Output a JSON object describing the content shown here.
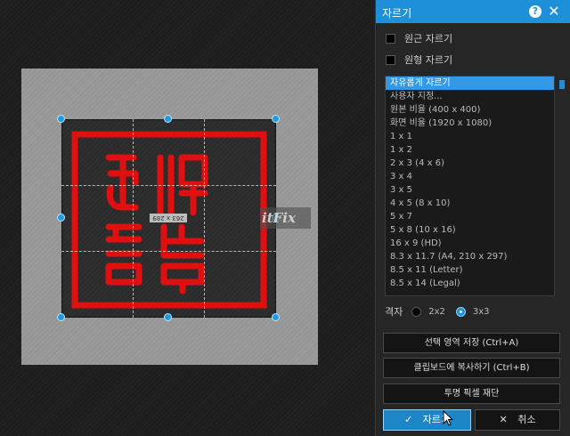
{
  "dialog": {
    "title": "자르기",
    "help_icon": "help-icon",
    "close_icon": "close-icon"
  },
  "options": {
    "circle_crop": "원근 자르기",
    "round_crop": "원형 자르기"
  },
  "ratio_list": {
    "selected_index": 0,
    "items": [
      "자유롭게 자르기",
      "사용자 지정...",
      "원본 비율 (400 x 400)",
      "화면 비율 (1920 x 1080)",
      "1 x 1",
      "1 x 2",
      "2 x 3 (4 x 6)",
      "3 x 4",
      "3 x 5",
      "4 x 5 (8 x 10)",
      "5 x 7",
      "5 x 8 (10 x 16)",
      "16 x 9 (HD)",
      "8.3 x 11.7 (A4, 210 x 297)",
      "8.5 x 11 (Letter)",
      "8.5 x 14 (Legal)"
    ]
  },
  "grid": {
    "label": "격자",
    "option_2x2": "2x2",
    "option_3x3": "3x3",
    "selected": "3x3"
  },
  "buttons": {
    "save_selection": "선택 영역 저장 (Ctrl+A)",
    "copy_clipboard": "클립보드에 복사하기 (Ctrl+B)",
    "trim_transparent": "투명 픽셀 재단",
    "ok": "자르기",
    "cancel": "취소"
  },
  "canvas": {
    "size_tag": "263 x 289",
    "watermark": "itFix"
  },
  "colors": {
    "accent": "#1e90d9",
    "seal_red": "#e01010",
    "selection": "#3399e6"
  }
}
